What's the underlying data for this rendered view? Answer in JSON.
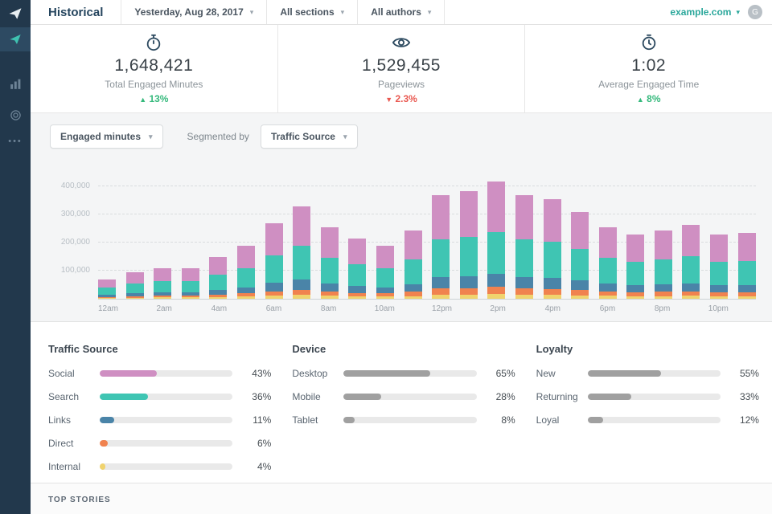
{
  "header": {
    "title": "Historical",
    "date_filter": "Yesterday, Aug 28, 2017",
    "sections_filter": "All sections",
    "authors_filter": "All authors",
    "domain": "example.com",
    "avatar_letter": "G"
  },
  "stats": [
    {
      "icon": "stopwatch-icon",
      "value": "1,648,421",
      "label": "Total Engaged Minutes",
      "delta": "13%",
      "direction": "up"
    },
    {
      "icon": "eye-icon",
      "value": "1,529,455",
      "label": "Pageviews",
      "delta": "2.3%",
      "direction": "down"
    },
    {
      "icon": "clock-icon",
      "value": "1:02",
      "label": "Average Engaged Time",
      "delta": "8%",
      "direction": "up"
    }
  ],
  "colors": {
    "accent_teal": "#3fc1b0",
    "green_up": "#35b97c",
    "red_down": "#e9574f",
    "social": "#cf8fc2",
    "search": "#3fc5b3",
    "links": "#4a84a8",
    "direct": "#f0824f",
    "internal": "#f0d36e",
    "neutral_bar": "#a0a0a0"
  },
  "chart_controls": {
    "metric": "Engaged minutes",
    "segmented_by_label": "Segmented by",
    "segment": "Traffic Source"
  },
  "chart_data": {
    "type": "bar",
    "stacked": true,
    "x": [
      "12am",
      "1am",
      "2am",
      "3am",
      "4am",
      "5am",
      "6am",
      "7am",
      "8am",
      "9am",
      "10am",
      "11am",
      "12pm",
      "1pm",
      "2pm",
      "3pm",
      "4pm",
      "5pm",
      "6pm",
      "7pm",
      "8pm",
      "9pm",
      "10pm",
      "11pm"
    ],
    "x_tick_labels": [
      "12am",
      "2am",
      "4am",
      "6am",
      "8am",
      "10am",
      "12pm",
      "2pm",
      "4pm",
      "6pm",
      "8pm",
      "10pm"
    ],
    "totals": [
      70000,
      95000,
      110000,
      110000,
      150000,
      190000,
      270000,
      330000,
      255000,
      215000,
      190000,
      245000,
      370000,
      385000,
      420000,
      370000,
      355000,
      310000,
      255000,
      230000,
      245000,
      265000,
      230000,
      235000
    ],
    "series": [
      {
        "name": "Internal",
        "color": "#f0d36e",
        "values": [
          2800,
          3800,
          4400,
          4400,
          6000,
          7600,
          10800,
          13200,
          10200,
          8600,
          7600,
          9800,
          14800,
          15400,
          16800,
          14800,
          14200,
          12400,
          10200,
          9200,
          9800,
          10600,
          9200,
          9400
        ]
      },
      {
        "name": "Direct",
        "color": "#f0824f",
        "values": [
          4200,
          5700,
          6600,
          6600,
          9000,
          11400,
          16200,
          19800,
          15300,
          12900,
          11400,
          14700,
          22200,
          23100,
          25200,
          22200,
          21300,
          18600,
          15300,
          13800,
          14700,
          15900,
          13800,
          14100
        ]
      },
      {
        "name": "Links",
        "color": "#4a84a8",
        "values": [
          7700,
          10450,
          12100,
          12100,
          16500,
          20900,
          29700,
          36300,
          28050,
          23650,
          20900,
          26950,
          40700,
          42350,
          46200,
          40700,
          39050,
          34100,
          28050,
          25300,
          26950,
          29150,
          25300,
          25850
        ]
      },
      {
        "name": "Search",
        "color": "#3fc5b3",
        "values": [
          25200,
          34200,
          39600,
          39600,
          54000,
          68400,
          97200,
          118800,
          91800,
          77400,
          68400,
          88200,
          133200,
          138600,
          151200,
          133200,
          127800,
          111600,
          91800,
          82800,
          88200,
          95400,
          82800,
          84600
        ]
      },
      {
        "name": "Social",
        "color": "#cf8fc2",
        "values": [
          30100,
          40850,
          47300,
          47300,
          64500,
          81700,
          116100,
          141900,
          109650,
          92450,
          81700,
          105350,
          159100,
          165550,
          180600,
          159100,
          152650,
          133300,
          109650,
          98900,
          105350,
          113950,
          98900,
          101050
        ]
      }
    ],
    "ylim": [
      0,
      450000
    ],
    "gridlines": [
      100000,
      200000,
      300000,
      400000
    ],
    "y_tick_labels": [
      "100,000",
      "200,000",
      "300,000",
      "400,000"
    ],
    "title": "",
    "xlabel": "",
    "ylabel": "",
    "legend_position": "none",
    "grid": true
  },
  "panels": [
    {
      "title": "Traffic Source",
      "rows": [
        {
          "label": "Social",
          "value": "43%",
          "pct": 43,
          "color": "#cf8fc2"
        },
        {
          "label": "Search",
          "value": "36%",
          "pct": 36,
          "color": "#3fc5b3"
        },
        {
          "label": "Links",
          "value": "11%",
          "pct": 11,
          "color": "#4a84a8"
        },
        {
          "label": "Direct",
          "value": "6%",
          "pct": 6,
          "color": "#f0824f"
        },
        {
          "label": "Internal",
          "value": "4%",
          "pct": 4,
          "color": "#f0d36e"
        }
      ]
    },
    {
      "title": "Device",
      "rows": [
        {
          "label": "Desktop",
          "value": "65%",
          "pct": 65,
          "color": "#a0a0a0"
        },
        {
          "label": "Mobile",
          "value": "28%",
          "pct": 28,
          "color": "#a0a0a0"
        },
        {
          "label": "Tablet",
          "value": "8%",
          "pct": 8,
          "color": "#a0a0a0"
        }
      ]
    },
    {
      "title": "Loyalty",
      "rows": [
        {
          "label": "New",
          "value": "55%",
          "pct": 55,
          "color": "#a0a0a0"
        },
        {
          "label": "Returning",
          "value": "33%",
          "pct": 33,
          "color": "#a0a0a0"
        },
        {
          "label": "Loyal",
          "value": "12%",
          "pct": 12,
          "color": "#a0a0a0"
        }
      ]
    }
  ],
  "footer": {
    "top_stories_label": "TOP STORIES"
  }
}
